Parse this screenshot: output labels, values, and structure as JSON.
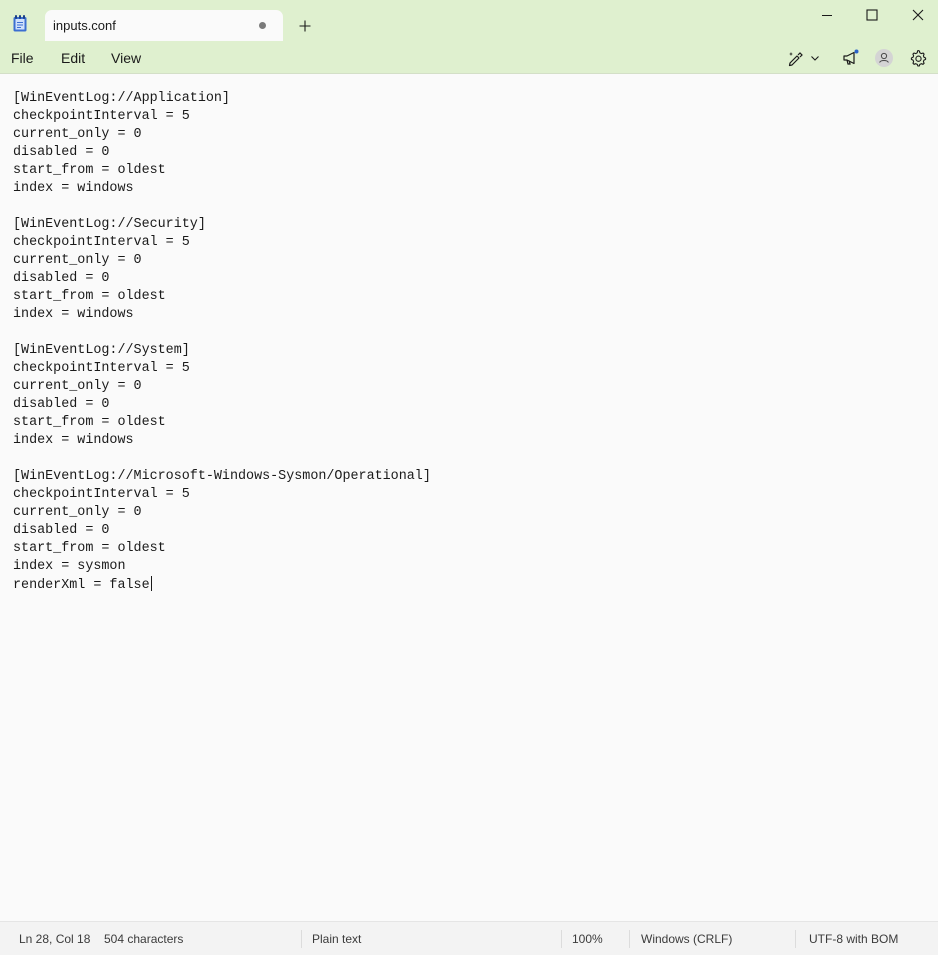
{
  "app": {
    "name": "Notepad"
  },
  "tab": {
    "title": "inputs.conf",
    "modified": true
  },
  "menu": {
    "file": "File",
    "edit": "Edit",
    "view": "View"
  },
  "toolbar": {
    "icons": [
      "copilot-pen-icon",
      "chevron-down-icon",
      "megaphone-icon",
      "account-icon",
      "gear-icon"
    ],
    "notification_dot_color": "#2a62c9"
  },
  "editor": {
    "lines": [
      "[WinEventLog://Application]",
      "checkpointInterval = 5",
      "current_only = 0",
      "disabled = 0",
      "start_from = oldest",
      "index = windows",
      "",
      "[WinEventLog://Security]",
      "checkpointInterval = 5",
      "current_only = 0",
      "disabled = 0",
      "start_from = oldest",
      "index = windows",
      "",
      "[WinEventLog://System]",
      "checkpointInterval = 5",
      "current_only = 0",
      "disabled = 0",
      "start_from = oldest",
      "index = windows",
      "",
      "[WinEventLog://Microsoft-Windows-Sysmon/Operational]",
      "checkpointInterval = 5",
      "current_only = 0",
      "disabled = 0",
      "start_from = oldest",
      "index = sysmon",
      "renderXml = false"
    ]
  },
  "status": {
    "position": "Ln 28, Col 18",
    "characters": "504 characters",
    "format": "Plain text",
    "zoom": "100%",
    "line_ending": "Windows (CRLF)",
    "encoding": "UTF-8 with BOM"
  },
  "colors": {
    "titlebar": "#dff0cf",
    "editor_bg": "#fafafa",
    "statusbar": "#f3f3f3"
  }
}
